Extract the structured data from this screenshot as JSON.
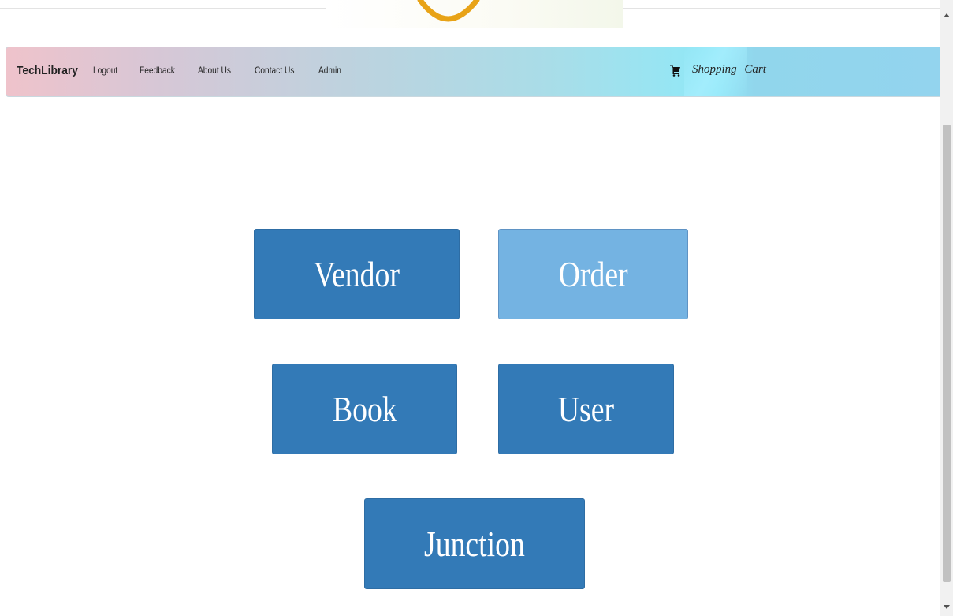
{
  "navbar": {
    "brand": "TechLibrary",
    "links": [
      "Logout",
      "Feedback",
      "About Us",
      "Contact Us",
      "Admin"
    ],
    "cart_label": "Shopping  Cart",
    "cart_icon": "cart-icon"
  },
  "tiles": {
    "vendor": "Vendor",
    "order": "Order",
    "book": "Book",
    "user": "User",
    "junction": "Junction"
  },
  "colors": {
    "tile": "#337ab7",
    "tile_hover": "#74b3e2",
    "logo_ring": "#e8a317"
  }
}
